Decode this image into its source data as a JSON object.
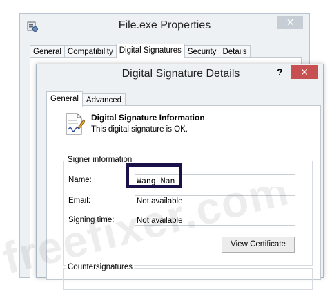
{
  "properties_window": {
    "title": "File.exe Properties",
    "close_symbol": "✕",
    "tabs": [
      "General",
      "Compatibility",
      "Digital Signatures",
      "Security",
      "Details"
    ],
    "active_tab_index": 2
  },
  "dialog": {
    "title": "Digital Signature Details",
    "help_symbol": "?",
    "close_symbol": "✕",
    "tabs": [
      "General",
      "Advanced"
    ],
    "active_tab_index": 0,
    "info_heading": "Digital Signature Information",
    "info_status": "This digital signature is OK.",
    "signer_group_label": "Signer information",
    "fields": {
      "name_label": "Name:",
      "name_value": "Wang Nan",
      "email_label": "Email:",
      "email_value": "Not available",
      "signing_time_label": "Signing time:",
      "signing_time_value": "Not available"
    },
    "view_certificate_label": "View Certificate",
    "countersignatures_label": "Countersignatures"
  },
  "watermark": {
    "text": "freefixer.com"
  },
  "colors": {
    "highlight_border": "#1b1149",
    "close_button_active": "#c75050",
    "close_button_inactive": "#c6cdd5",
    "window_background": "#eef1f4"
  },
  "icons": {
    "app_icon": "properties-app-icon",
    "signature_icon": "document-signature-icon"
  }
}
